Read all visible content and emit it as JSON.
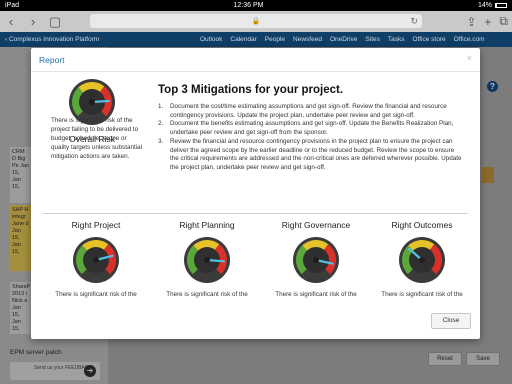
{
  "status_bar": {
    "device": "iPad",
    "time": "12:36 PM",
    "battery": "14%"
  },
  "suite_bar": {
    "app_name": "Complexus Innovation Platform",
    "links": [
      "Outlook",
      "Calendar",
      "People",
      "Newsfeed",
      "OneDrive",
      "Sites",
      "Tasks",
      "Office store",
      "Office.com"
    ]
  },
  "background": {
    "cards": [
      {
        "text": "CRM D Big Pe Jan 15, Jan 15,"
      },
      {
        "text": "SAP H integr Jane d Jan 15, Jan 15,"
      },
      {
        "text": "ShareP 2013 i Nick a Jan 15, Jan 15,"
      }
    ],
    "bottom_item": "EPM server patch",
    "feedback": "Send us your FEEDBACK",
    "reset_label": "Reset",
    "save_label": "Save"
  },
  "modal": {
    "title": "Report",
    "close_icon": "×",
    "overall": {
      "title": "Overall Risk",
      "risk_level": 0.82,
      "description": "There is significant risk of the project failing to be delivered to budget, schedule, scope or quality targets unless substantial mitigation actions are taken."
    },
    "mitigations": {
      "title": "Top 3 Mitigations for your project.",
      "items": [
        "Document the cost/time estimating assumptions and get sign-off. Review the financial and resource contingency provisions. Update the project plan, undertake peer review and get sign-off.",
        "Document the benefits estimating assumptions and get sign-off. Update the Benefits Realization Plan, undertake peer review and get sign-off from the sponsor.",
        "Review the financial and resource contingency provisions in the project plan to ensure the project can deliver the agreed scope by the earlier deadline or to the reduced budget. Review the scope to ensure the critical requirements are addressed and the non-critical ones are deferred wherever possible. Update the project plan, undertake peer review and get sign-off."
      ]
    },
    "categories": [
      {
        "title": "Right Project",
        "description": "There is significant risk of the",
        "risk_level": 0.78
      },
      {
        "title": "Right Planning",
        "description": "There is significant risk of the",
        "risk_level": 0.85
      },
      {
        "title": "Right Governance",
        "description": "There is significant risk of the",
        "risk_level": 0.88
      },
      {
        "title": "Right Outcomes",
        "description": "There is significant risk of the",
        "risk_level": 0.32
      }
    ],
    "close_button": "Close"
  },
  "colors": {
    "accent": "#1f6fa8",
    "suite_bar": "#0f3e66",
    "gauge_green": "#5aa83a",
    "gauge_yellow": "#e6c229",
    "gauge_red": "#d9302a",
    "needle": "#55c0e6"
  }
}
